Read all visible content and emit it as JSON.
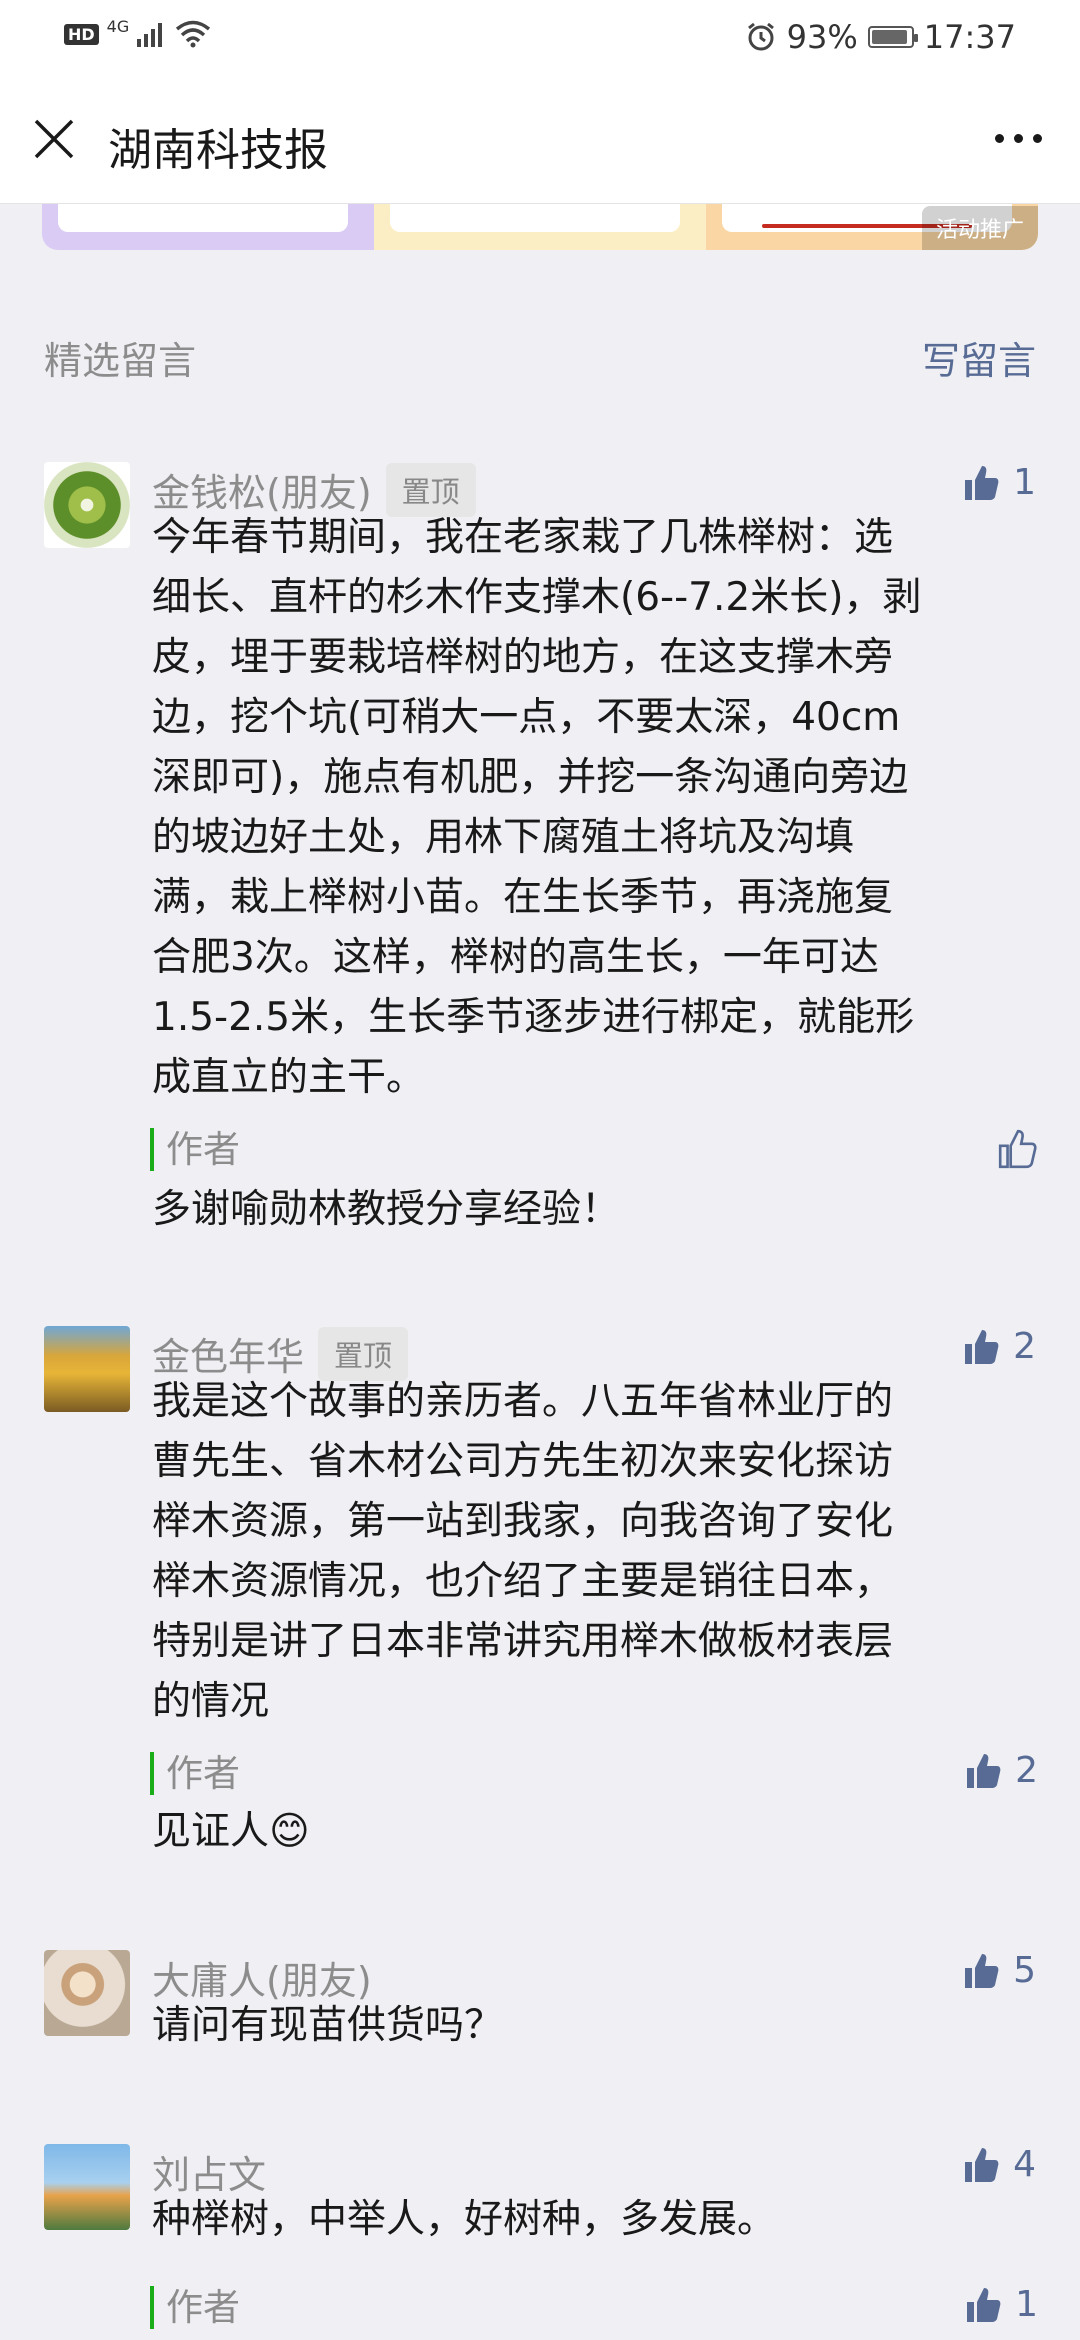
{
  "status_bar": {
    "hd": "HD",
    "network": "4G",
    "battery_pct": "93%",
    "battery_level": 0.93,
    "time": "17:37",
    "icons": [
      "hd-icon",
      "signal-icon",
      "wifi-icon",
      "alarm-icon",
      "battery-icon"
    ]
  },
  "nav": {
    "title": "湖南科技报",
    "close_icon": "close-icon",
    "more_icon": "more-icon"
  },
  "promo": {
    "badge": "活动推广",
    "colors": [
      "#d9cbf4",
      "#fbeec4",
      "#f9d6a3"
    ]
  },
  "comments_section": {
    "title": "精选留言",
    "write_label": "写留言"
  },
  "comments": [
    {
      "name": "金钱松(朋友)",
      "pinned": "置顶",
      "likes": "1",
      "lines": [
        "今年春节期间，我在老家栽了几株榉树：选",
        "细长、直杆的杉木作支撑木(6--7.2米长)，剥",
        "皮，埋于要栽培榉树的地方，在这支撑木旁",
        "边，挖个坑(可稍大一点，不要太深，40cm",
        "深即可)，施点有机肥，并挖一条沟通向旁边",
        "的坡边好土处，用林下腐殖土将坑及沟填",
        "满，栽上榉树小苗。在生长季节，再浇施复",
        "合肥3次。这样，榉树的高生长，一年可达",
        "1.5-2.5米，生长季节逐步进行梆定，就能形",
        "成直立的主干。"
      ],
      "author_label": "作者",
      "author_reply": "多谢喻勋林教授分享经验！",
      "author_likes": ""
    },
    {
      "name": "金色年华",
      "pinned": "置顶",
      "likes": "2",
      "lines": [
        "我是这个故事的亲历者。八五年省林业厅的",
        "曹先生、省木材公司方先生初次来安化探访",
        "榉木资源，第一站到我家，向我咨询了安化",
        "榉木资源情况，也介绍了主要是销往日本，",
        "特别是讲了日本非常讲究用榉木做板材表层",
        "的情况"
      ],
      "author_label": "作者",
      "author_reply": "见证人😊",
      "author_likes": "2"
    },
    {
      "name": "大庸人(朋友)",
      "likes": "5",
      "text": "请问有现苗供货吗？"
    },
    {
      "name": "刘占文",
      "likes": "4",
      "text": "种榉树，中举人，好树种，多发展。",
      "author_label": "作者",
      "author_likes": "1"
    }
  ]
}
